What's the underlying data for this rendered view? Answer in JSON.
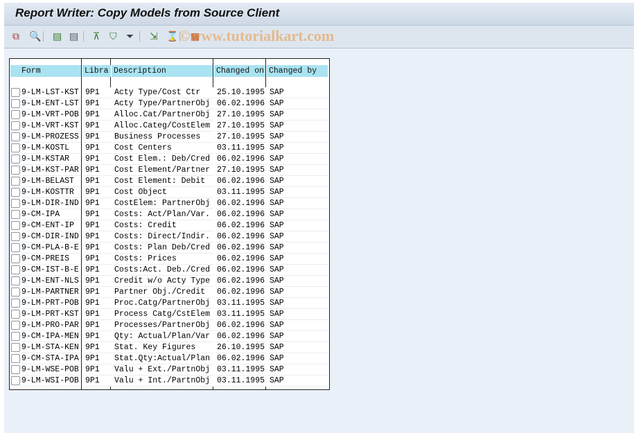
{
  "title": "Report Writer: Copy Models from Source Client",
  "watermark": "©www.tutorialkart.com",
  "toolbar": [
    "copy-icon",
    "find-icon",
    "select-all-icon",
    "deselect-all-icon",
    "sort-ascending-icon",
    "filter-icon",
    "set-filter-icon",
    "export-icon",
    "print-preview-icon",
    "layout-icon"
  ],
  "columns": [
    "Form",
    "Libra",
    "Description",
    "Changed on",
    "Changed by"
  ],
  "rows": [
    [
      "9-LM-LST-KST",
      "9P1",
      "Acty Type/Cost Ctr",
      "25.10.1995",
      "SAP"
    ],
    [
      "9-LM-ENT-LST",
      "9P1",
      "Acty Type/PartnerObj",
      "06.02.1996",
      "SAP"
    ],
    [
      "9-LM-VRT-POB",
      "9P1",
      "Alloc.Cat/PartnerObj",
      "27.10.1995",
      "SAP"
    ],
    [
      "9-LM-VRT-KST",
      "9P1",
      "Alloc.Categ/CostElem",
      "27.10.1995",
      "SAP"
    ],
    [
      "9-LM-PROZESS",
      "9P1",
      "Business Processes",
      "27.10.1995",
      "SAP"
    ],
    [
      "9-LM-KOSTL",
      "9P1",
      "Cost Centers",
      "03.11.1995",
      "SAP"
    ],
    [
      "9-LM-KSTAR",
      "9P1",
      "Cost Elem.: Deb/Cred",
      "06.02.1996",
      "SAP"
    ],
    [
      "9-LM-KST-PAR",
      "9P1",
      "Cost Element/Partner",
      "27.10.1995",
      "SAP"
    ],
    [
      "9-LM-BELAST",
      "9P1",
      "Cost Element: Debit",
      "06.02.1996",
      "SAP"
    ],
    [
      "9-LM-KOSTTR",
      "9P1",
      "Cost Object",
      "03.11.1995",
      "SAP"
    ],
    [
      "9-LM-DIR-IND",
      "9P1",
      "CostElem: PartnerObj",
      "06.02.1996",
      "SAP"
    ],
    [
      "9-CM-IPA",
      "9P1",
      "Costs: Act/Plan/Var.",
      "06.02.1996",
      "SAP"
    ],
    [
      "9-CM-ENT-IP",
      "9P1",
      "Costs: Credit",
      "06.02.1996",
      "SAP"
    ],
    [
      "9-CM-DIR-IND",
      "9P1",
      "Costs: Direct/Indir.",
      "06.02.1996",
      "SAP"
    ],
    [
      "9-CM-PLA-B-E",
      "9P1",
      "Costs: Plan Deb/Cred",
      "06.02.1996",
      "SAP"
    ],
    [
      "9-CM-PREIS",
      "9P1",
      "Costs: Prices",
      "06.02.1996",
      "SAP"
    ],
    [
      "9-CM-IST-B-E",
      "9P1",
      "Costs:Act. Deb./Cred",
      "06.02.1996",
      "SAP"
    ],
    [
      "9-LM-ENT-NLS",
      "9P1",
      "Credit w/o Acty Type",
      "06.02.1996",
      "SAP"
    ],
    [
      "9-LM-PARTNER",
      "9P1",
      "Partner Obj./Credit",
      "06.02.1996",
      "SAP"
    ],
    [
      "9-LM-PRT-POB",
      "9P1",
      "Proc.Catg/PartnerObj",
      "03.11.1995",
      "SAP"
    ],
    [
      "9-LM-PRT-KST",
      "9P1",
      "Process Catg/CstElem",
      "03.11.1995",
      "SAP"
    ],
    [
      "9-LM-PRO-PAR",
      "9P1",
      "Processes/PartnerObj",
      "06.02.1996",
      "SAP"
    ],
    [
      "9-CM-IPA-MEN",
      "9P1",
      "Qty: Actual/Plan/Var",
      "06.02.1996",
      "SAP"
    ],
    [
      "9-LM-STA-KEN",
      "9P1",
      "Stat. Key Figures",
      "26.10.1995",
      "SAP"
    ],
    [
      "9-CM-STA-IPA",
      "9P1",
      "Stat.Qty:Actual/Plan",
      "06.02.1996",
      "SAP"
    ],
    [
      "9-LM-WSE-POB",
      "9P1",
      "Valu + Ext./PartnObj",
      "03.11.1995",
      "SAP"
    ],
    [
      "9-LM-WSI-POB",
      "9P1",
      "Valu + Int./PartnObj",
      "03.11.1995",
      "SAP"
    ]
  ]
}
